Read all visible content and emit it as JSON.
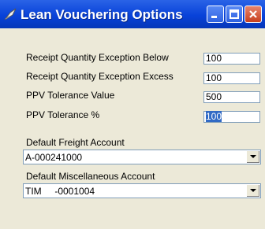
{
  "window": {
    "title": "Lean Vouchering Options",
    "buttons": {
      "minimize": "minimize",
      "maximize": "maximize",
      "close": "close"
    }
  },
  "fields": [
    {
      "label": "Receipt Quantity Exception Below",
      "value": "100"
    },
    {
      "label": "Receipt Quantity Exception Excess",
      "value": "100"
    },
    {
      "label": "PPV Tolerance Value",
      "value": "500"
    },
    {
      "label": "PPV Tolerance %",
      "value": "100"
    }
  ],
  "freight": {
    "label": "Default Freight Account",
    "value": "A-000241000"
  },
  "misc": {
    "label": "Default Miscellaneous Account",
    "value": "TIM     -0001004"
  },
  "colors": {
    "titlebar": "#0842d9",
    "body": "#ece9d8",
    "selection": "#316ac5"
  }
}
